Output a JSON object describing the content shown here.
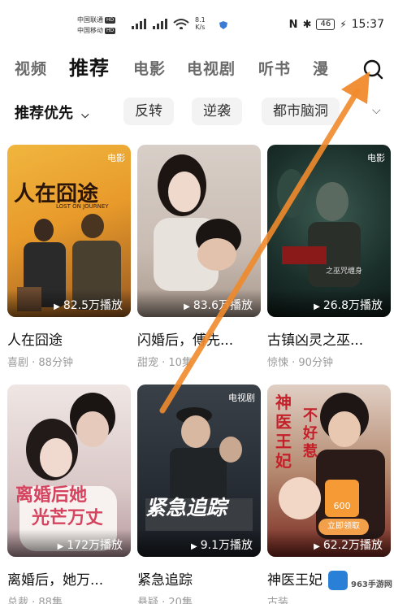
{
  "status_bar": {
    "carrier1": "中国联通",
    "carrier2": "中国移动",
    "hd": "HD",
    "speed_value": "8.1",
    "speed_unit": "K/s",
    "battery": "46",
    "time": "15:37",
    "icons": [
      "nfc-icon",
      "bluetooth-icon",
      "battery-icon",
      "charging-icon",
      "wifi-icon",
      "signal-icon"
    ]
  },
  "tabs": [
    "视频",
    "推荐",
    "电影",
    "电视剧",
    "听书",
    "漫"
  ],
  "active_tab": "推荐",
  "filters": {
    "main": "推荐优先",
    "chips": [
      "反转",
      "逆袭",
      "都市脑洞"
    ]
  },
  "cards": [
    {
      "title": "人在囧途",
      "meta": "喜剧 · 88分钟",
      "plays": "82.5万播放",
      "badge": "电影",
      "poster_text": "人在囧途",
      "poster_sub": "LOST ON JOURNEY"
    },
    {
      "title": "闪婚后，傅先...",
      "meta": "甜宠 · 10集",
      "plays": "83.6万播放",
      "badge": "",
      "poster_text": "",
      "poster_sub": ""
    },
    {
      "title": "古镇凶灵之巫...",
      "meta": "惊悚 · 90分钟",
      "plays": "26.8万播放",
      "badge": "电影",
      "poster_text": "古镇凶灵",
      "poster_sub": "之巫咒缠身"
    },
    {
      "title": "离婚后，她万...",
      "meta": "总裁 · 88集",
      "plays": "172万播放",
      "badge": "",
      "poster_text": "离婚后她",
      "poster_sub": "光芒万丈"
    },
    {
      "title": "紧急追踪",
      "meta": "悬疑 · 20集",
      "plays": "9.1万播放",
      "badge": "电视剧",
      "poster_text": "紧急追踪",
      "poster_sub": ""
    },
    {
      "title": "神医王妃",
      "meta": "古装",
      "plays": "62.2万播放",
      "badge": "",
      "poster_text": "神医王妃",
      "poster_sub": "不好惹"
    }
  ],
  "promo": {
    "coin": "600",
    "button": "立即领取"
  },
  "watermark": {
    "text": "963手游网"
  },
  "colors": {
    "arrow": "#f08a2c",
    "active_tab": "#111111",
    "inactive_tab": "#6a6a6a",
    "meta": "#9a9a9a"
  }
}
